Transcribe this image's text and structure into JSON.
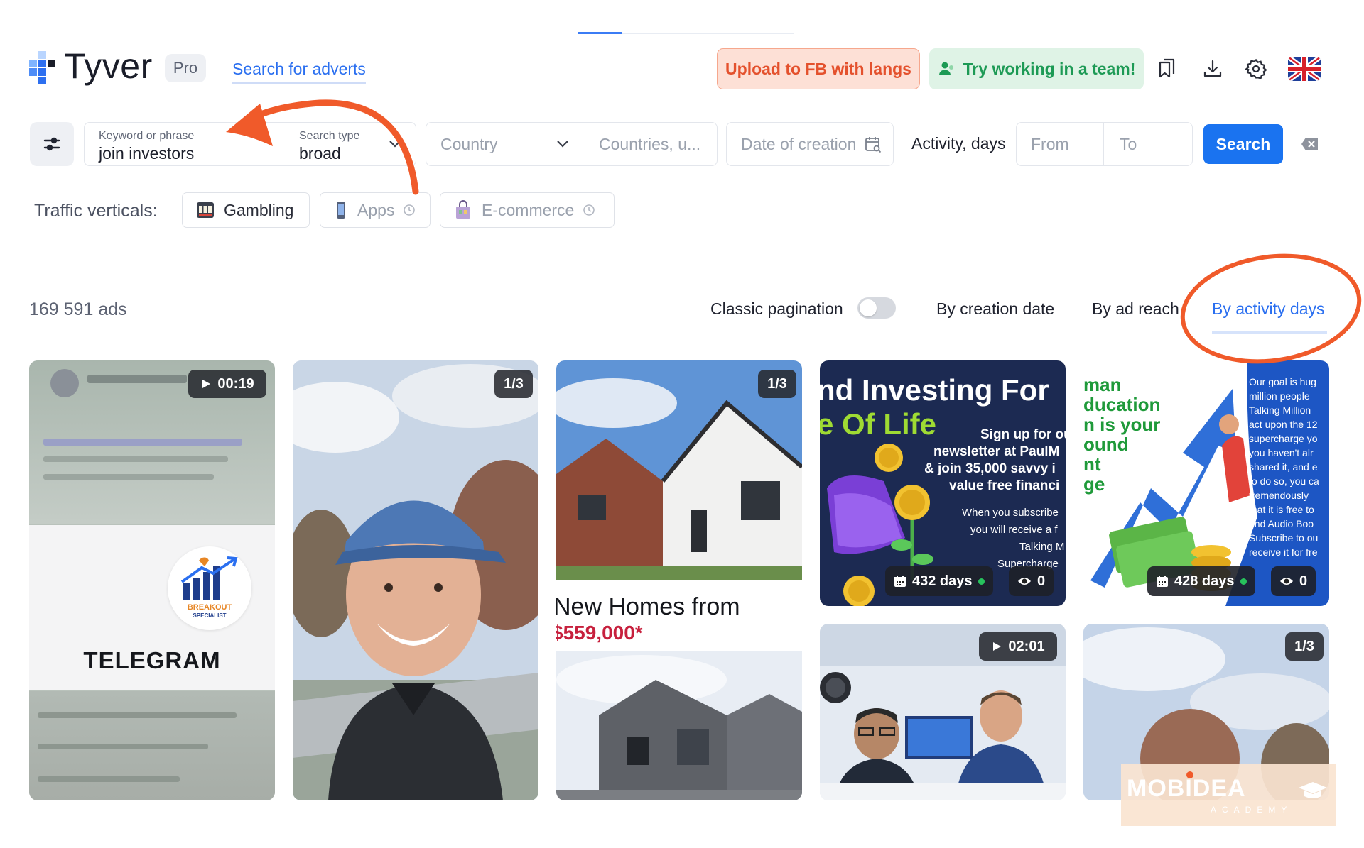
{
  "header": {
    "logo_text": "Tyver",
    "plan_badge": "Pro",
    "search_adverts_link": "Search for adverts",
    "upload_button": "Upload to FB with langs",
    "team_button": "Try working in a team!",
    "icons": [
      "bookmarks-icon",
      "download-icon",
      "settings-icon",
      "uk-flag-icon"
    ]
  },
  "filters": {
    "keyword_label": "Keyword or phrase",
    "keyword_value": "join investors",
    "search_type_label": "Search type",
    "search_type_value": "broad",
    "country_placeholder": "Country",
    "countries_placeholder": "Countries, u...",
    "date_placeholder": "Date of creation",
    "activity_label": "Activity, days",
    "from_placeholder": "From",
    "to_placeholder": "To",
    "search_button": "Search"
  },
  "verticals": {
    "label": "Traffic verticals:",
    "items": [
      {
        "label": "Gambling",
        "icon": "slot-machine-icon",
        "locked": false
      },
      {
        "label": "Apps",
        "icon": "phone-icon",
        "locked": true
      },
      {
        "label": "E-commerce",
        "icon": "shopping-bag-icon",
        "locked": true
      }
    ]
  },
  "results": {
    "count": "169 591 ads",
    "classic_pagination_label": "Classic pagination",
    "classic_pagination_on": false,
    "sort_options": [
      "By creation date",
      "By ad reach",
      "By activity days"
    ],
    "active_sort": "By activity days"
  },
  "cards": [
    {
      "badge": "00:19",
      "badge_type": "video",
      "overlay_text": "TELEGRAM",
      "logo_text": "BREAKOUT",
      "logo_sub": "SPECIALIST"
    },
    {
      "badge": "1/3",
      "badge_type": "carousel"
    },
    {
      "badge": "1/3",
      "badge_type": "carousel",
      "headline_1": "New Homes from",
      "headline_2": "$559,000*"
    },
    {
      "headline_1": "nd Investing For",
      "headline_2": "e Of Life",
      "body_1": "Sign up for ou",
      "body_2": "newsletter at PaulM",
      "body_3": "& join 35,000 savvy i",
      "body_4": "value free financi",
      "body_5": "When you subscribe",
      "body_6": "you will receive a f",
      "body_7": "Talking M",
      "body_8": "Supercharge",
      "days": "432 days",
      "views": "0"
    },
    {
      "left_text": [
        "man",
        "ducation",
        "n is your",
        "ound",
        "nt",
        "ge"
      ],
      "right_text": [
        "Our goal is hug",
        "million people",
        "Talking Million",
        "act upon the 12",
        "supercharge yo",
        "you haven't alr",
        "shared it, and e",
        "to do so, you ca",
        "tremendously",
        "that it is free to",
        "and Audio Boo",
        "Subscribe to ou",
        "receive it for fre"
      ],
      "days": "428 days",
      "views": "0"
    },
    {
      "badge": "02:01",
      "badge_type": "video"
    },
    {
      "badge": "1/3",
      "badge_type": "carousel"
    }
  ],
  "watermark": {
    "brand": "MOBIDEA",
    "sub": "ACADEMY"
  },
  "colors": {
    "accent": "#1a73f0",
    "upload_orange": "#e4512d",
    "team_green": "#1d9a55",
    "annotation": "#f05a2a"
  }
}
